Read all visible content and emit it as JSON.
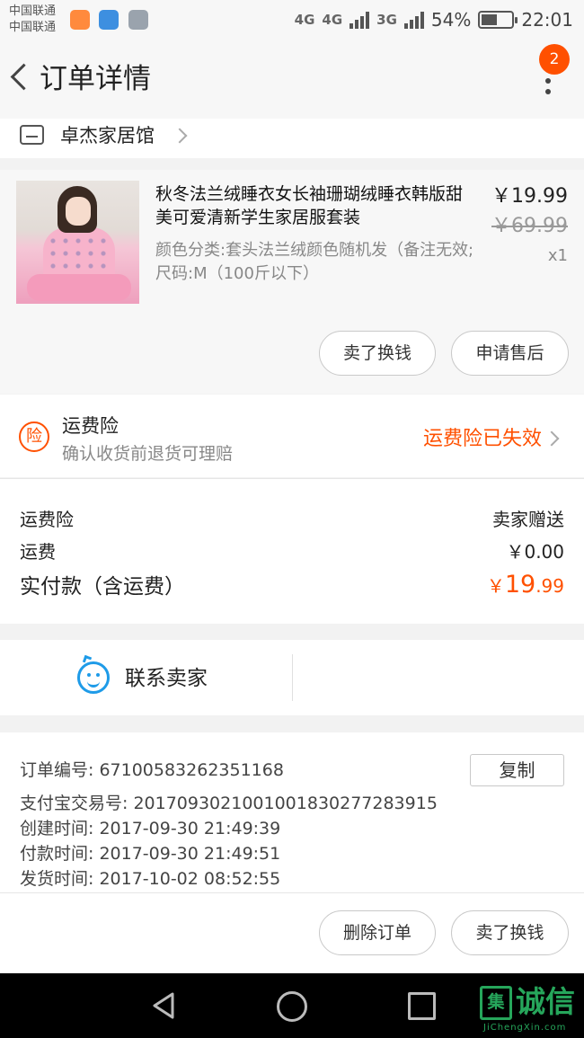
{
  "status_bar": {
    "carrier_1": "中国联通",
    "carrier_2": "中国联通",
    "network_1": "4G",
    "network_2": "4G",
    "network_3": "3G",
    "battery": "54%",
    "battery_level": 0.54,
    "time": "22:01"
  },
  "header": {
    "title": "订单详情",
    "badge_count": "2"
  },
  "shop": {
    "name": "卓杰家居馆"
  },
  "product": {
    "title": "秋冬法兰绒睡衣女长袖珊瑚绒睡衣韩版甜美可爱清新学生家居服套装",
    "sku": "颜色分类:套头法兰绒颜色随机发（备注无效;尺码:M（100斤以下）",
    "price": "￥19.99",
    "original_price": "￥69.99",
    "quantity": "x1",
    "btn_resell": "卖了换钱",
    "btn_aftersale": "申请售后"
  },
  "insurance": {
    "icon_char": "险",
    "title": "运费险",
    "subtitle": "确认收货前退货可理赔",
    "status": "运费险已失效"
  },
  "fees": {
    "insurance_label": "运费险",
    "insurance_value": "卖家赠送",
    "shipping_label": "运费",
    "shipping_value": "￥0.00",
    "total_label": "实付款（含运费）",
    "total_currency": "￥",
    "total_integer": "19",
    "total_decimal": ".99"
  },
  "contact": {
    "label": "联系卖家"
  },
  "order_info": {
    "order_no": "订单编号:   67100583262351168",
    "alipay_no": "支付宝交易号:   2017093021001001830277283915",
    "created": "创建时间:   2017-09-30 21:49:39",
    "paid": "付款时间:   2017-09-30 21:49:51",
    "shipped": "发货时间:   2017-10-02 08:52:55",
    "copy_label": "复制"
  },
  "actions": {
    "delete_label": "删除订单",
    "resell_label": "卖了换钱"
  },
  "watermark": {
    "box_char": "集",
    "text": "诚信",
    "url": "JiChengXin.com"
  },
  "colors": {
    "accent": "#ff5000",
    "contact_blue": "#1e9be8",
    "watermark_green": "#26a65b"
  },
  "icons": {
    "back": "chevron-left-icon",
    "more": "more-vertical-icon",
    "shop": "store-icon",
    "insurance": "insurance-icon",
    "contact": "chat-smile-icon"
  }
}
